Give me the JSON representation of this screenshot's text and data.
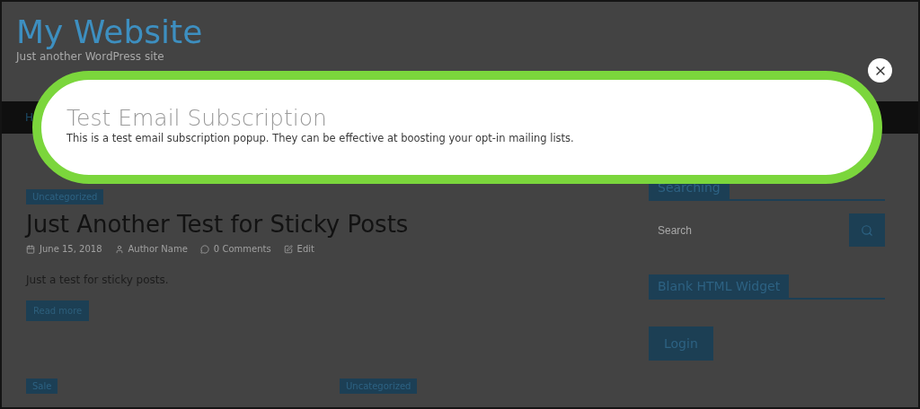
{
  "site": {
    "title": "My Website",
    "tagline": "Just another WordPress site"
  },
  "nav": {
    "items": [
      {
        "label": "H"
      }
    ]
  },
  "posts": [
    {
      "category": "Uncategorized",
      "title": "Just Another Test for Sticky Posts",
      "meta": [
        {
          "kind": "date",
          "text": "June 15, 2018"
        },
        {
          "kind": "author",
          "text": "Author Name"
        },
        {
          "kind": "comments",
          "text": "0 Comments"
        },
        {
          "kind": "edit",
          "text": "Edit"
        }
      ],
      "excerpt": "Just a test for sticky posts.",
      "button": "Read more"
    }
  ],
  "more_posts": [
    {
      "category": "Sale"
    },
    {
      "category": "Uncategorized"
    }
  ],
  "sidebar": {
    "widgets": [
      {
        "kind": "search",
        "title": "Searching",
        "placeholder": "Search"
      },
      {
        "kind": "html",
        "title": "Blank HTML Widget",
        "button": "Login"
      }
    ]
  },
  "popup": {
    "title": "Test Email Subscription",
    "text": "This is a test email subscription popup. They can be effective at boosting your opt-in mailing lists."
  }
}
